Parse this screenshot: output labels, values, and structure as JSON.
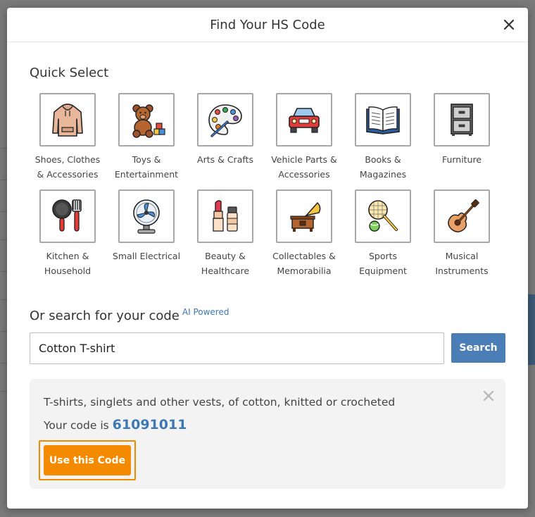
{
  "modal": {
    "title": "Find Your HS Code"
  },
  "quick_select": {
    "title": "Quick Select",
    "categories": [
      {
        "label_1": "Shoes, Clothes",
        "label_2": "& Accessories",
        "icon": "hoodie-icon"
      },
      {
        "label_1": "Toys &",
        "label_2": "Entertainment",
        "icon": "teddy-bear-icon"
      },
      {
        "label_1": "Arts & Crafts",
        "label_2": "",
        "icon": "paint-palette-icon"
      },
      {
        "label_1": "Vehicle Parts &",
        "label_2": "Accessories",
        "icon": "car-icon"
      },
      {
        "label_1": "Books &",
        "label_2": "Magazines",
        "icon": "open-book-icon"
      },
      {
        "label_1": "Furniture",
        "label_2": "",
        "icon": "cabinet-icon"
      },
      {
        "label_1": "Kitchen &",
        "label_2": "Household",
        "icon": "frying-pan-icon"
      },
      {
        "label_1": "Small Electrical",
        "label_2": "",
        "icon": "fan-icon"
      },
      {
        "label_1": "Beauty &",
        "label_2": "Healthcare",
        "icon": "lipstick-icon"
      },
      {
        "label_1": "Collectables &",
        "label_2": "Memorabilia",
        "icon": "gramophone-icon"
      },
      {
        "label_1": "Sports",
        "label_2": "Equipment",
        "icon": "tennis-racket-icon"
      },
      {
        "label_1": "Musical",
        "label_2": "Instruments",
        "icon": "guitar-icon"
      }
    ]
  },
  "search": {
    "title": "Or search for your code",
    "ai_tag": "AI Powered",
    "value": "Cotton T-shirt",
    "button_label": "Search"
  },
  "result": {
    "description": "T-shirts, singlets and other vests, of cotton, knitted or crocheted",
    "code_prefix": "Your code is",
    "code": "61091011",
    "use_button_label": "Use this Code"
  },
  "colors": {
    "accent_blue": "#4b7db6",
    "code_blue": "#3d78b3",
    "orange": "#f48a00"
  }
}
